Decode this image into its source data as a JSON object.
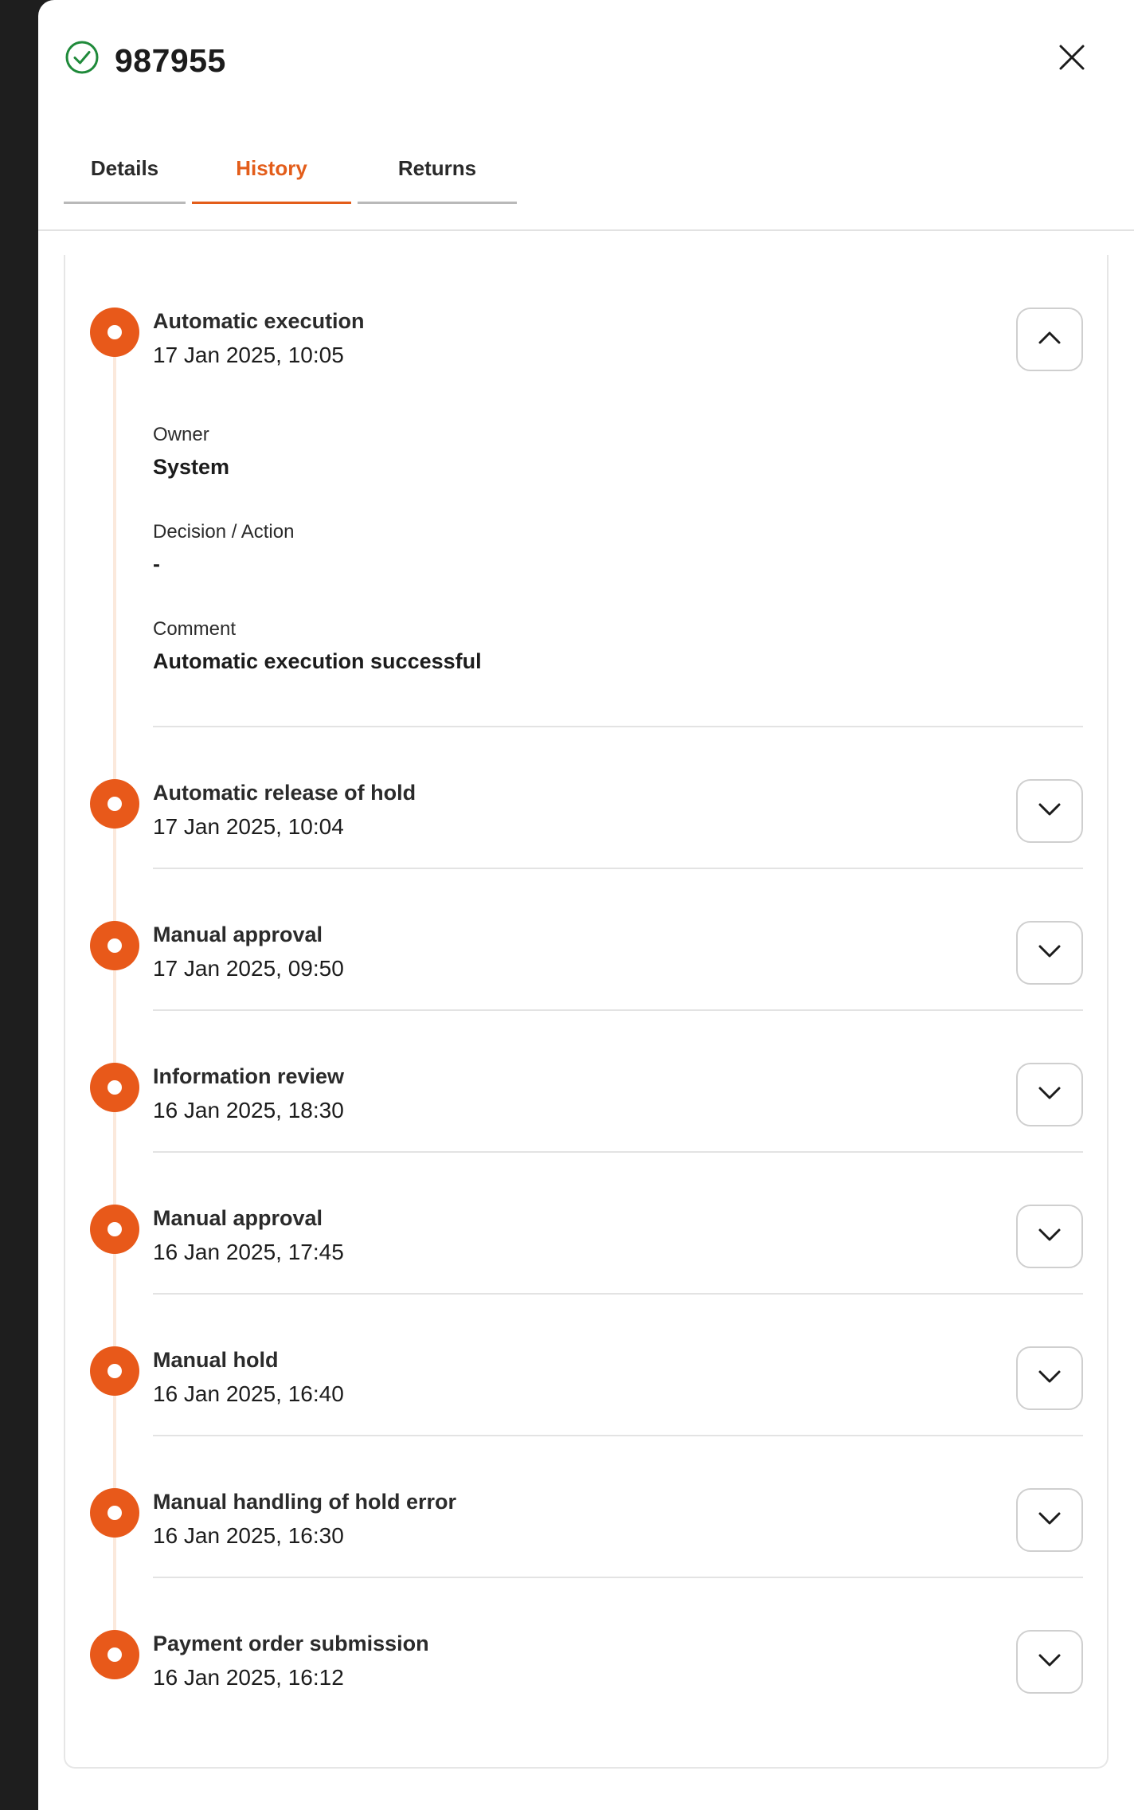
{
  "header": {
    "title": "987955",
    "status_icon": "check-circle-icon",
    "close_icon": "close-icon",
    "status_color": "#1f8a3a"
  },
  "tabs": [
    {
      "label": "Details",
      "active": false
    },
    {
      "label": "History",
      "active": true
    },
    {
      "label": "Returns",
      "active": false
    }
  ],
  "accent_color": "#e35d1a",
  "history": {
    "expanded": {
      "title": "Automatic execution",
      "date": "17 Jan 2025, 10:05",
      "fields": [
        {
          "label": "Owner",
          "value": "System"
        },
        {
          "label": "Decision / Action",
          "value": "-"
        },
        {
          "label": "Comment",
          "value": "Automatic execution successful"
        }
      ]
    },
    "events": [
      {
        "title": "Automatic release of hold",
        "date": "17 Jan 2025, 10:04"
      },
      {
        "title": "Manual approval",
        "date": "17 Jan 2025, 09:50"
      },
      {
        "title": "Information review",
        "date": "16 Jan 2025, 18:30"
      },
      {
        "title": "Manual approval",
        "date": "16 Jan 2025, 17:45"
      },
      {
        "title": "Manual hold",
        "date": "16 Jan 2025, 16:40"
      },
      {
        "title": "Manual handling of hold error",
        "date": "16 Jan 2025, 16:30"
      },
      {
        "title": "Payment order submission",
        "date": "16 Jan 2025, 16:12"
      }
    ]
  }
}
